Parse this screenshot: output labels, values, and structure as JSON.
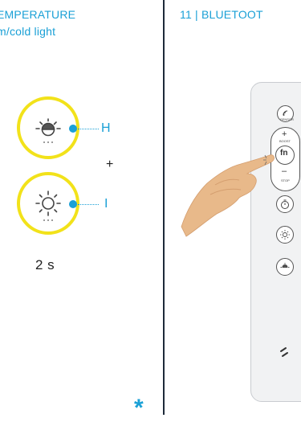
{
  "left_panel": {
    "heading_line1": "EMPERATURE",
    "heading_line2": "m/cold light",
    "label_h": "H",
    "plus_sign": "+",
    "label_i": "I",
    "duration": "2 s",
    "icon_warm": "warm-light-icon",
    "icon_cold": "cold-light-icon",
    "accent_color": "#1aa0d6",
    "highlight_color": "#f2e21a"
  },
  "right_panel": {
    "heading": "11 | BLUETOOT",
    "remote": {
      "sensor_label": "SENSOR",
      "boost_label": "BOOST",
      "fn_label": "fn",
      "stop_label": "STOP",
      "plus_label": "+",
      "minus_label": "–"
    }
  },
  "footer": {
    "asterisk": "*"
  }
}
